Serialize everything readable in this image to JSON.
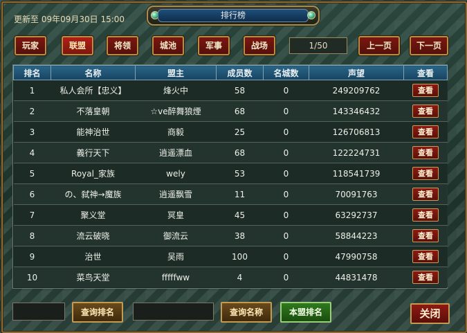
{
  "header": {
    "title": "排行榜",
    "updated": "更新至 09年09月30日 15:00"
  },
  "tabs": [
    {
      "label": "玩家",
      "active": false
    },
    {
      "label": "联盟",
      "active": true
    },
    {
      "label": "将领",
      "active": false
    },
    {
      "label": "城池",
      "active": false
    },
    {
      "label": "军事",
      "active": false
    },
    {
      "label": "战场",
      "active": false
    }
  ],
  "pagination": {
    "page": "1/50",
    "prev": "上一页",
    "next": "下一页"
  },
  "table": {
    "headers": [
      "排名",
      "名称",
      "盟主",
      "成员数",
      "名城数",
      "声望",
      "查看"
    ],
    "rows": [
      {
        "rank": "1",
        "name": "私人会所【忠义】",
        "leader": "烽火中",
        "members": "58",
        "cities": "0",
        "prestige": "249209762",
        "view": "查看"
      },
      {
        "rank": "2",
        "name": "不落皇朝",
        "leader": "☆ve醉舞狼煙",
        "members": "68",
        "cities": "0",
        "prestige": "143346432",
        "view": "查看"
      },
      {
        "rank": "3",
        "name": "能神治世",
        "leader": "商毅",
        "members": "25",
        "cities": "0",
        "prestige": "126706813",
        "view": "查看"
      },
      {
        "rank": "4",
        "name": "義行天下",
        "leader": "逍遥漂血",
        "members": "68",
        "cities": "0",
        "prestige": "122224731",
        "view": "查看"
      },
      {
        "rank": "5",
        "name": "Royal_家族",
        "leader": "wely",
        "members": "53",
        "cities": "0",
        "prestige": "118541739",
        "view": "查看"
      },
      {
        "rank": "6",
        "name": "の、弑神→魔族",
        "leader": "逍遥飘雪",
        "members": "11",
        "cities": "0",
        "prestige": "70091763",
        "view": "查看"
      },
      {
        "rank": "7",
        "name": "聚义堂",
        "leader": "冥皇",
        "members": "45",
        "cities": "0",
        "prestige": "63292737",
        "view": "查看"
      },
      {
        "rank": "8",
        "name": "流云破晓",
        "leader": "御流云",
        "members": "38",
        "cities": "0",
        "prestige": "58844223",
        "view": "查看"
      },
      {
        "rank": "9",
        "name": "治世",
        "leader": "吴雨",
        "members": "100",
        "cities": "0",
        "prestige": "47990758",
        "view": "查看"
      },
      {
        "rank": "10",
        "name": "菜鸟天堂",
        "leader": "fffffww",
        "members": "4",
        "cities": "0",
        "prestige": "44831478",
        "view": "查看"
      }
    ]
  },
  "footer": {
    "rank_input": "",
    "query_rank": "查询排名",
    "name_input": "",
    "query_name": "查询名称",
    "my_rank": "本盟排名",
    "close": "关闭"
  }
}
